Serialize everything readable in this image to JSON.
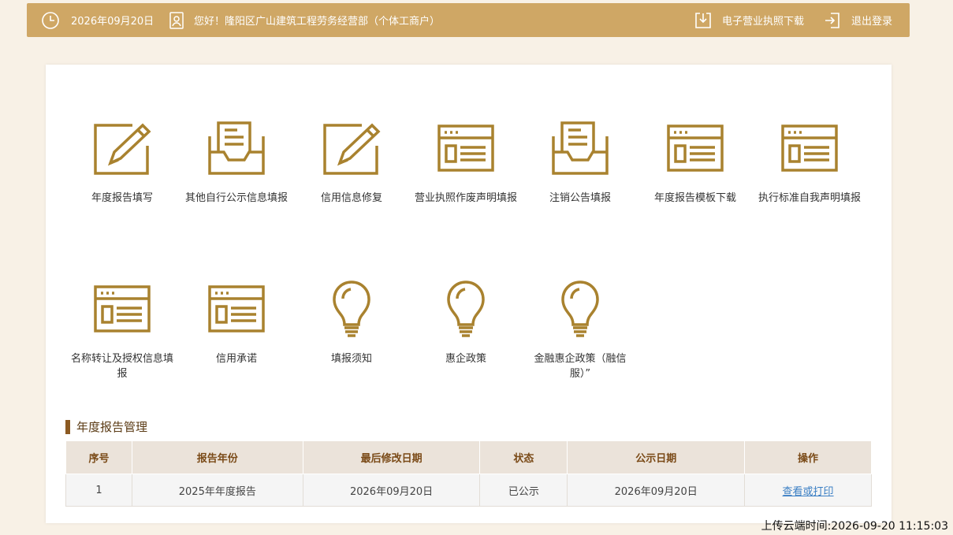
{
  "header": {
    "date": "2026年09月20日",
    "greeting": "您好！隆阳区广山建筑工程劳务经营部（个体工商户）",
    "download_label": "电子营业执照下载",
    "logout_label": "退出登录"
  },
  "colors": {
    "topbar": "#cfa765",
    "icon": "#a9822f",
    "accent": "#8c5a22"
  },
  "tiles": [
    {
      "label": "年度报告填写",
      "icon": "edit-pen-icon"
    },
    {
      "label": "其他自行公示信息填报",
      "icon": "inbox-doc-icon"
    },
    {
      "label": "信用信息修复",
      "icon": "edit-pen-icon"
    },
    {
      "label": "营业执照作废声明填报",
      "icon": "browser-form-icon"
    },
    {
      "label": "注销公告填报",
      "icon": "inbox-doc-icon"
    },
    {
      "label": "年度报告模板下载",
      "icon": "browser-form-icon"
    },
    {
      "label": "执行标准自我声明填报",
      "icon": "browser-form-icon"
    },
    {
      "label": "名称转让及授权信息填报",
      "icon": "browser-form-icon"
    },
    {
      "label": "信用承诺",
      "icon": "browser-form-icon"
    },
    {
      "label": "填报须知",
      "icon": "lightbulb-icon"
    },
    {
      "label": "惠企政策",
      "icon": "lightbulb-icon"
    },
    {
      "label": "金融惠企政策（融信服）”",
      "icon": "lightbulb-icon"
    }
  ],
  "section": {
    "title": "年度报告管理"
  },
  "table": {
    "headers": [
      "序号",
      "报告年份",
      "最后修改日期",
      "状态",
      "公示日期",
      "操作"
    ],
    "rows": [
      [
        "1",
        "2025年年度报告",
        "2026年09月20日",
        "已公示",
        "2026年09月20日",
        "查看或打印"
      ]
    ]
  },
  "footer": {
    "upload_time": "上传云端时间:2026-09-20 11:15:03"
  }
}
